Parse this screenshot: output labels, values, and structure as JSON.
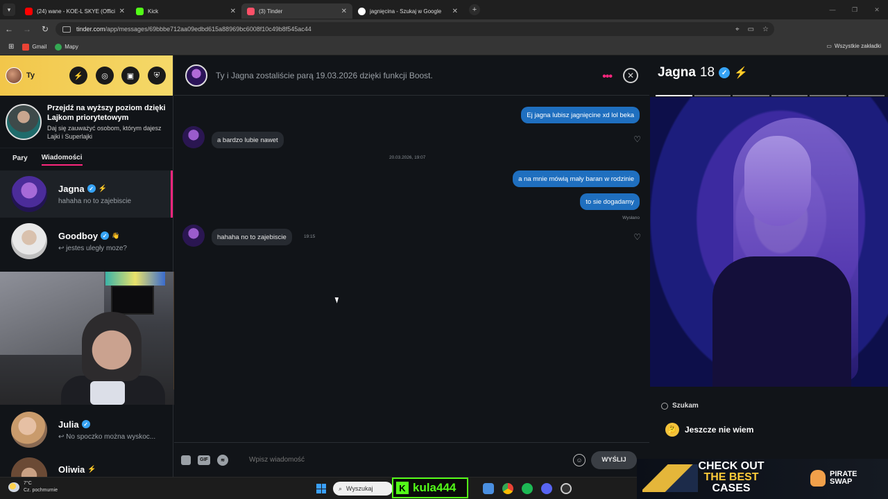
{
  "browser": {
    "tabs": [
      {
        "label": "(24) wane - KOE-L SKYE (Officia",
        "fav_color": "#ff0000",
        "active": false
      },
      {
        "label": "Kick",
        "fav_color": "#53fc18",
        "active": false
      },
      {
        "label": "(3) Tinder",
        "fav_color": "#fd5068",
        "active": true
      },
      {
        "label": "jagnięcina - Szukaj w Google",
        "fav_color": "#ffffff",
        "active": false
      }
    ],
    "url_host": "tinder.com",
    "url_path": "/app/messages/69bbbe712aa09edbd615a88969bc6008f10c49b8f545ac44",
    "bookmarks": [
      {
        "label": "Gmail",
        "color": "#ea4335"
      },
      {
        "label": "Mapy",
        "color": "#34a853"
      }
    ],
    "bookmarks_right": "Wszystkie zakładki"
  },
  "sidebar": {
    "me_label": "Ty",
    "promo_title": "Przejdź na wyższy poziom dzięki Lajkom priorytetowym",
    "promo_sub": "Daj się zauważyć osobom, którym dajesz Lajki i Superlajki",
    "tabs": [
      "Pary",
      "Wiadomości"
    ],
    "conversations": [
      {
        "name": "Jagna",
        "last": "hahaha no to zajebiscie",
        "selected": true
      },
      {
        "name": "Goodboy",
        "last": "↩ jestes uległy moze?",
        "selected": false
      },
      {
        "name": "Julia",
        "last": "↩ No spoczko można wyskoc...",
        "selected": false
      },
      {
        "name": "Oliwia",
        "last": "",
        "selected": false
      }
    ]
  },
  "chat": {
    "header": "Ty i Jagna zostaliście parą 19.03.2026 dzięki funkcji Boost.",
    "messages": [
      {
        "dir": "out",
        "text": "Ej jagna lubisz jagnięcine xd lol beka"
      },
      {
        "dir": "in",
        "text": "a bardzo lubie nawet"
      },
      {
        "dir": "out",
        "text": "a na mnie mówią mały baran w rodzinie"
      },
      {
        "dir": "out",
        "text": "to sie dogadamy"
      },
      {
        "dir": "in",
        "text": "hahaha no to zajebiscie"
      }
    ],
    "date_separator": "20.03.2026, 19:07",
    "sent_status": "Wysłano",
    "last_time": "19:15",
    "composer_placeholder": "Wpisz wiadomość",
    "gif_label": "GIF",
    "send_label": "WYŚLIJ"
  },
  "profile": {
    "name": "Jagna",
    "age": "18",
    "photo_count": 6,
    "active_photo": 1,
    "looking_label": "Szukam",
    "looking_value": "Jeszcze nie wiem"
  },
  "ad": {
    "line1": "CHECK OUT",
    "line2": "THE BEST",
    "line3": "CASES",
    "brand1": "PIRATE",
    "brand2": "SWAP"
  },
  "taskbar": {
    "temp": "7°C",
    "weather": "Cz. pochmurnie",
    "search": "Wyszukaj",
    "kick_name": "kula444"
  }
}
